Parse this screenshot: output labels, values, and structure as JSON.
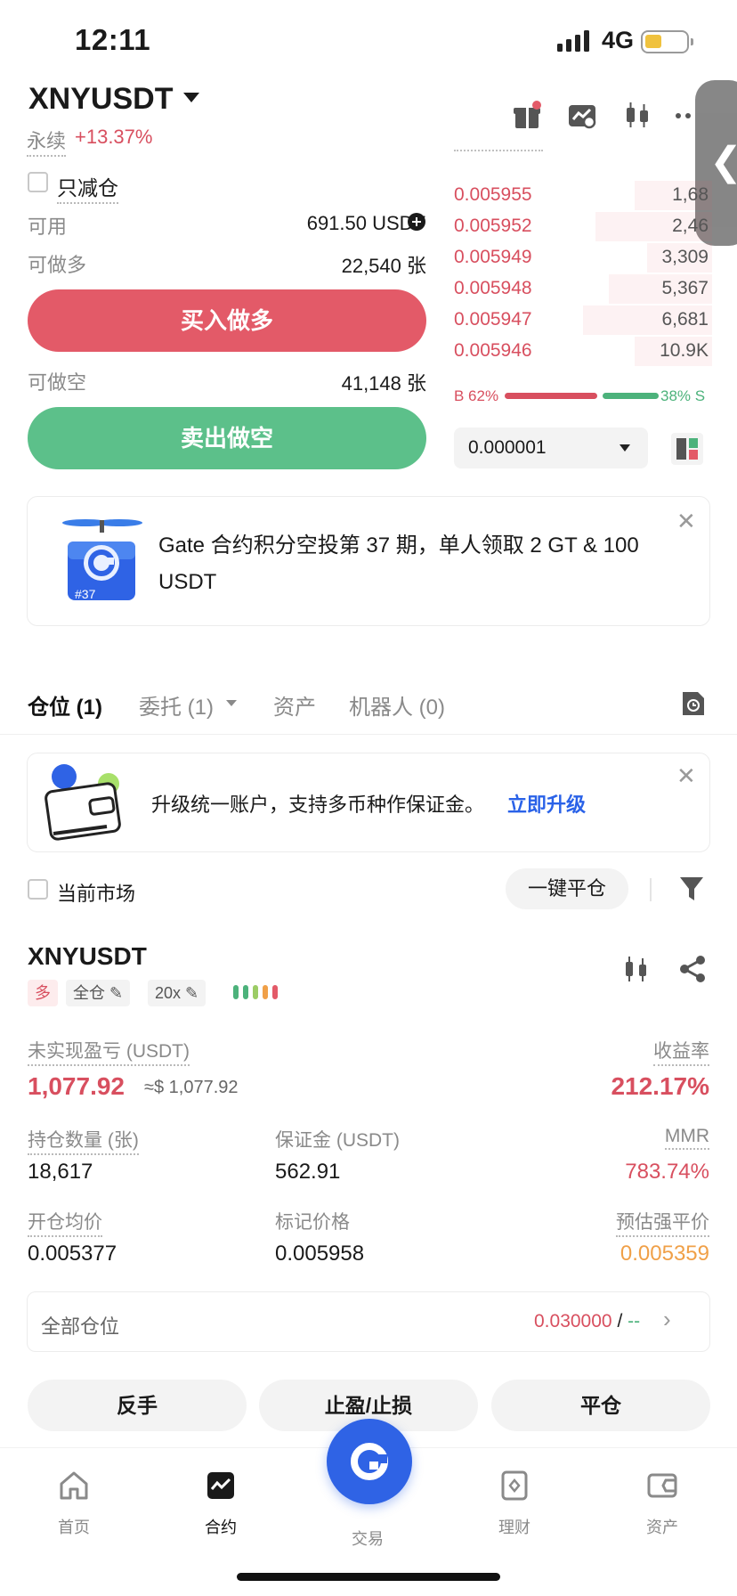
{
  "status_bar": {
    "time": "12:11",
    "network": "4G"
  },
  "header": {
    "pair": "XNYUSDT",
    "contract_type": "永续",
    "change": "+13.37%"
  },
  "order_form": {
    "reduce_only_label": "只减仓",
    "available_label": "可用",
    "available_value": "691.50 USDT",
    "max_long_label": "可做多",
    "max_long_value": "22,540 张",
    "buy_label": "买入做多",
    "max_short_label": "可做空",
    "max_short_value": "41,148 张",
    "sell_label": "卖出做空"
  },
  "order_book": {
    "asks": [
      {
        "price": "0.005955",
        "qty": "1,68",
        "depth": 0.3
      },
      {
        "price": "0.005952",
        "qty": "2,46",
        "depth": 0.45
      },
      {
        "price": "0.005949",
        "qty": "3,309",
        "depth": 0.25
      },
      {
        "price": "0.005948",
        "qty": "5,367",
        "depth": 0.4
      },
      {
        "price": "0.005947",
        "qty": "6,681",
        "depth": 0.5
      },
      {
        "price": "0.005946",
        "qty": "10.9K",
        "depth": 0.3
      }
    ],
    "buy_ratio": "B 62%",
    "sell_ratio": "38% S",
    "buy_fraction": 0.62,
    "precision": "0.000001"
  },
  "promo": {
    "text": "Gate 合约积分空投第 37 期，单人领取 2 GT & 100 USDT",
    "badge": "#37"
  },
  "tabs": [
    {
      "label": "仓位 (1)"
    },
    {
      "label": "委托 (1)"
    },
    {
      "label": "资产"
    },
    {
      "label": "机器人 (0)"
    }
  ],
  "upgrade_banner": {
    "text": "升级统一账户，支持多币种作保证金。",
    "link": "立即升级"
  },
  "filters": {
    "current_market_label": "当前市场",
    "close_all_label": "一键平仓"
  },
  "position": {
    "symbol": "XNYUSDT",
    "side": "多",
    "margin_mode": "全仓",
    "leverage": "20x",
    "unrealized_label": "未实现盈亏 (USDT)",
    "unrealized_value": "1,077.92",
    "unrealized_approx": "≈$ 1,077.92",
    "roe_label": "收益率",
    "roe_value": "212.17%",
    "size_label": "持仓数量 (张)",
    "size_value": "18,617",
    "margin_label": "保证金 (USDT)",
    "margin_value": "562.91",
    "mmr_label": "MMR",
    "mmr_value": "783.74%",
    "entry_label": "开仓均价",
    "entry_value": "0.005377",
    "mark_label": "标记价格",
    "mark_value": "0.005958",
    "liq_label": "预估强平价",
    "liq_value": "0.005359",
    "total_label": "全部仓位",
    "total_value": "0.030000",
    "total_sep": "/",
    "total_suffix": "--",
    "reverse_label": "反手",
    "tpsl_label": "止盈/止损",
    "close_label": "平仓"
  },
  "bottom_nav": [
    {
      "label": "首页"
    },
    {
      "label": "合约"
    },
    {
      "label": "交易"
    },
    {
      "label": "理财"
    },
    {
      "label": "资产"
    }
  ],
  "colors": {
    "red": "#d84f5f",
    "green": "#4cb27b",
    "blue": "#2f63e5",
    "orange": "#f0a048"
  }
}
